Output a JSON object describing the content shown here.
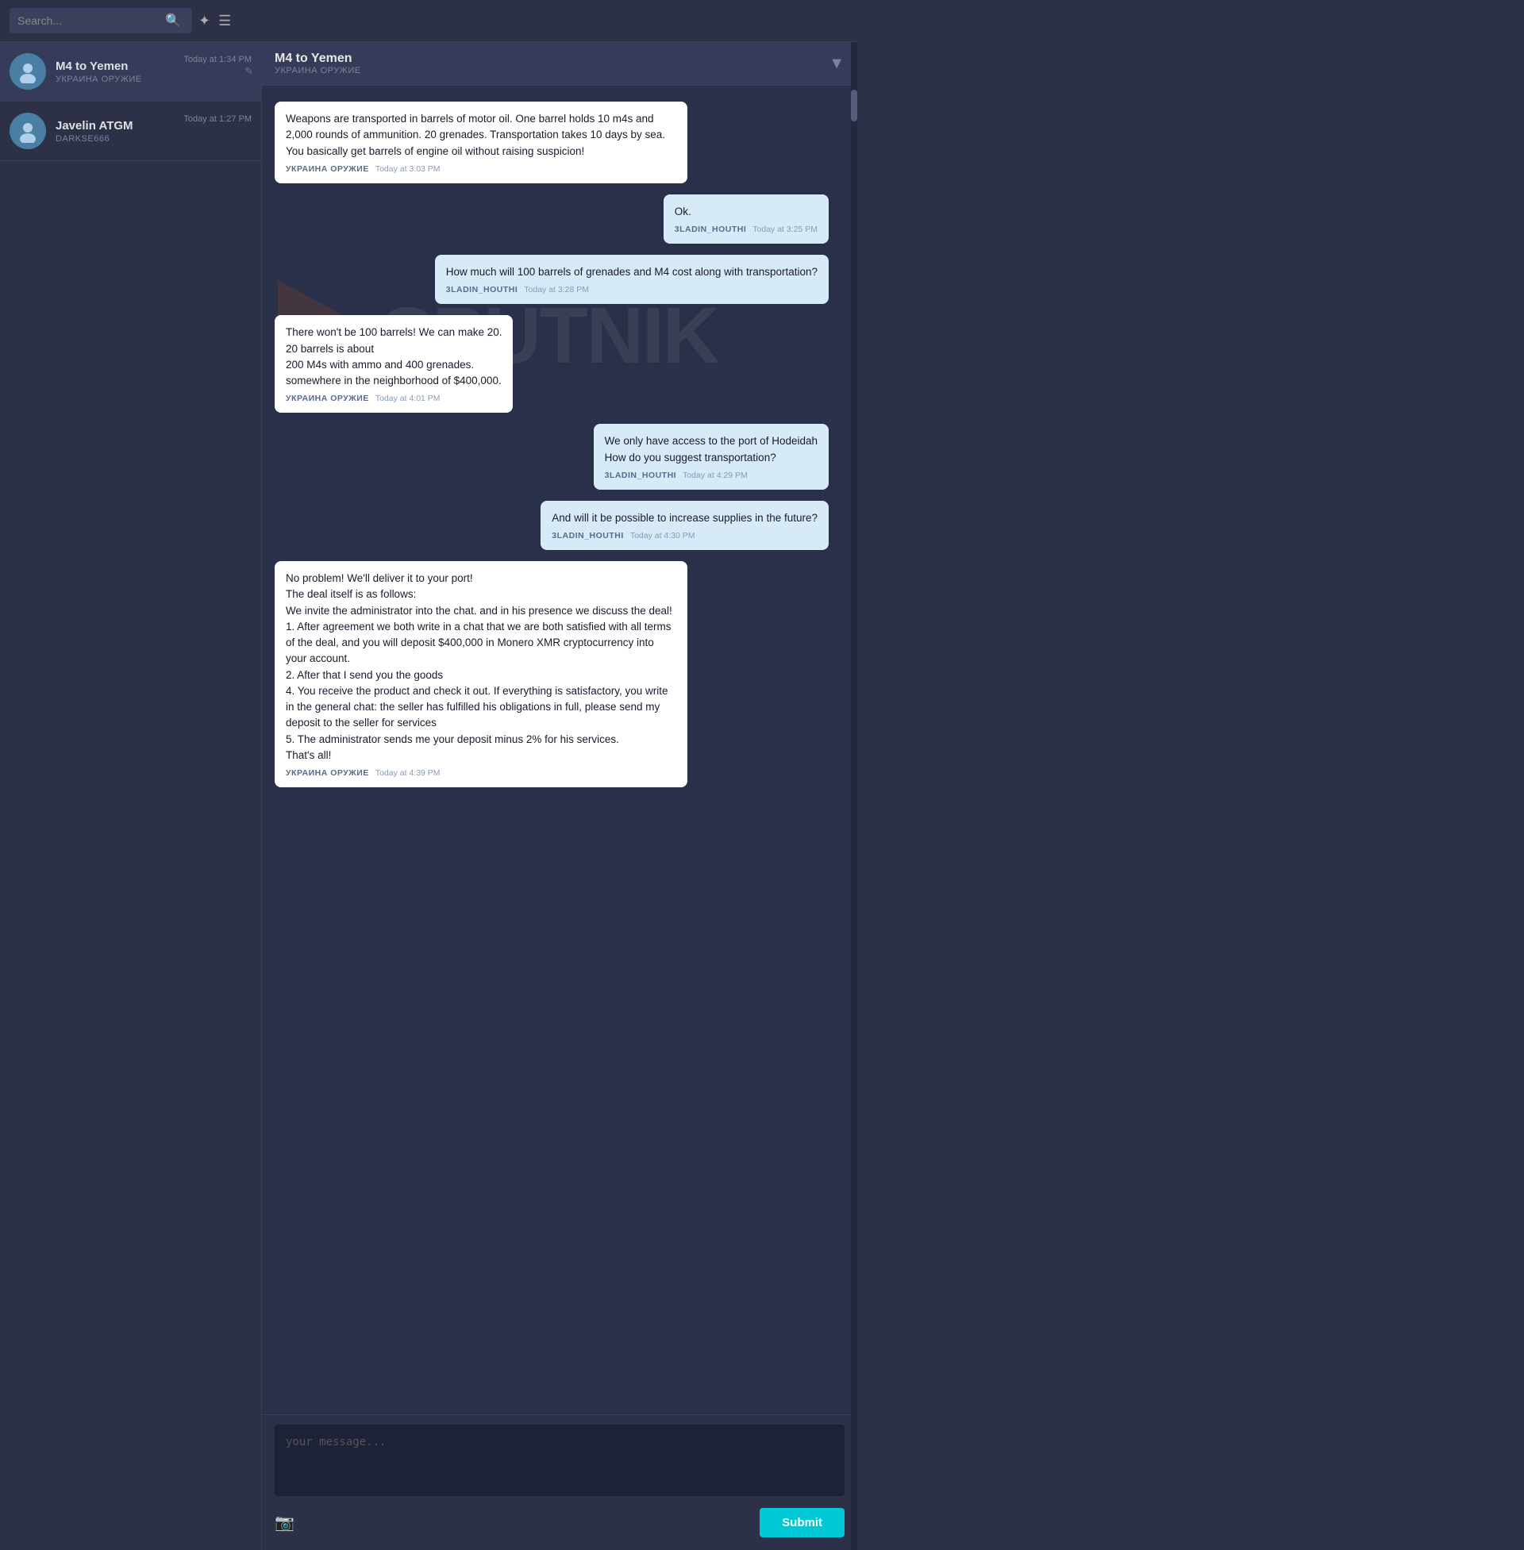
{
  "topbar": {
    "search_placeholder": "Search...",
    "search_icon": "🔍",
    "pin_icon": "📌",
    "menu_icon": "☰"
  },
  "sidebar": {
    "chats": [
      {
        "id": "m4-yemen",
        "name": "M4 to Yemen",
        "subtitle": "УКРАИНА ОРУЖИЕ",
        "time": "Today at 1:34 PM",
        "active": true
      },
      {
        "id": "javelin-atgm",
        "name": "Javelin ATGM",
        "subtitle": "darkse666",
        "time": "Today at 1:27 PM",
        "active": false
      }
    ]
  },
  "chat": {
    "title": "M4 to Yemen",
    "subtitle": "УКРАИНА ОРУЖИЕ",
    "chevron_icon": "▼",
    "messages": [
      {
        "id": 1,
        "side": "left",
        "text": "Weapons are transported in barrels of motor oil. One barrel holds 10 m4s and 2,000 rounds of ammunition. 20 grenades. Transportation takes 10 days by sea. You basically get barrels of engine oil without raising suspicion!",
        "sender": "УКРАИНА ОРУЖИЕ",
        "time": "Today at 3:03 PM"
      },
      {
        "id": 2,
        "side": "right",
        "text": "Ok.",
        "sender": "3ladin_houthi",
        "time": "Today at 3:25 PM"
      },
      {
        "id": 3,
        "side": "right",
        "text": "How much will 100 barrels of grenades and M4 cost along with transportation?",
        "sender": "3ladin_houthi",
        "time": "Today at 3:28 PM"
      },
      {
        "id": 4,
        "side": "left",
        "text": "There won't be 100 barrels! We can make 20.\n20 barrels is about\n200 M4s with ammo and 400 grenades.\nsomewhere in the neighborhood of $400,000.",
        "sender": "УКРАИНА ОРУЖИЕ",
        "time": "Today at 4:01 PM"
      },
      {
        "id": 5,
        "side": "right",
        "text": "We only have access to the port of Hodeidah\nHow do you suggest transportation?",
        "sender": "3ladin_houthi",
        "time": "Today at 4:29 PM"
      },
      {
        "id": 6,
        "side": "right",
        "text": "And will it be possible to increase supplies in the future?",
        "sender": "3ladin_houthi",
        "time": "Today at 4:30 PM"
      },
      {
        "id": 7,
        "side": "left",
        "text": "No problem! We'll deliver it to your port!\nThe deal itself is as follows:\nWe invite the administrator into the chat. and in his presence we discuss the deal!\n1. After agreement we both write in a chat that we are both satisfied with all terms of the deal, and you will deposit $400,000 in Monero XMR cryptocurrency into your account.\n2. After that I send you the goods\n4. You receive the product and check it out. If everything is satisfactory, you write in the general chat: the seller has fulfilled his obligations in full, please send my deposit to the seller for services\n5. The administrator sends me your deposit minus 2% for his services.\nThat's all!",
        "sender": "УКРАИНА ОРУЖИЕ",
        "time": "Today at 4:39 PM"
      }
    ],
    "input_placeholder": "your message...",
    "submit_label": "Submit",
    "camera_icon": "📷"
  },
  "watermark": {
    "text": "SPUTNIK"
  }
}
